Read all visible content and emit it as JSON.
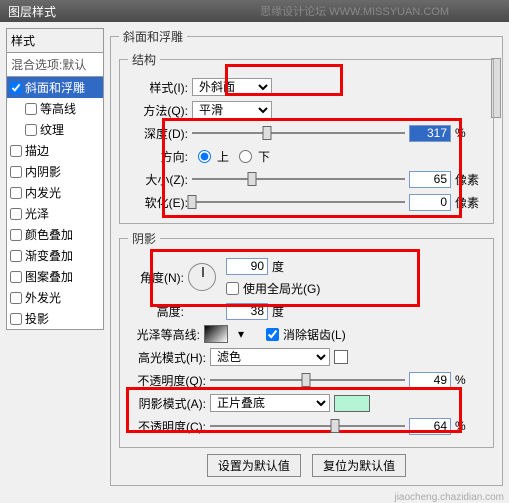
{
  "window": {
    "title": "图层样式"
  },
  "watermark": "思缘设计论坛 WWW.MISSYUAN.COM",
  "sidebar": {
    "header": "样式",
    "default": "混合选项:默认",
    "items": [
      {
        "label": "斜面和浮雕",
        "checked": true,
        "selected": true
      },
      {
        "label": "等高线",
        "checked": false,
        "indent": true
      },
      {
        "label": "纹理",
        "checked": false,
        "indent": true
      },
      {
        "label": "描边",
        "checked": false
      },
      {
        "label": "内阴影",
        "checked": false
      },
      {
        "label": "内发光",
        "checked": false
      },
      {
        "label": "光泽",
        "checked": false
      },
      {
        "label": "颜色叠加",
        "checked": false
      },
      {
        "label": "渐变叠加",
        "checked": false
      },
      {
        "label": "图案叠加",
        "checked": false
      },
      {
        "label": "外发光",
        "checked": false
      },
      {
        "label": "投影",
        "checked": false
      }
    ]
  },
  "panel": {
    "title": "斜面和浮雕",
    "structure": {
      "legend": "结构",
      "style_label": "样式(I):",
      "style_value": "外斜面",
      "method_label": "方法(Q):",
      "method_value": "平滑",
      "depth_label": "深度(D):",
      "depth_value": "317",
      "depth_unit": "%",
      "direction_label": "方向:",
      "up": "上",
      "down": "下",
      "size_label": "大小(Z):",
      "size_value": "65",
      "size_unit": "像素",
      "soften_label": "软化(E):",
      "soften_value": "0",
      "soften_unit": "像素"
    },
    "shadow": {
      "legend": "阴影",
      "angle_label": "角度(N):",
      "angle_value": "90",
      "angle_unit": "度",
      "global_label": "使用全局光(G)",
      "altitude_label": "高度:",
      "altitude_value": "38",
      "altitude_unit": "度",
      "gloss_label": "光泽等高线:",
      "antialias_label": "消除锯齿(L)",
      "hilite_mode_label": "高光模式(H):",
      "hilite_mode_value": "滤色",
      "hilite_op_label": "不透明度(Q):",
      "hilite_op_value": "49",
      "hilite_op_unit": "%",
      "shadow_mode_label": "阴影模式(A):",
      "shadow_mode_value": "正片叠底",
      "shadow_op_label": "不透明度(C):",
      "shadow_op_value": "64",
      "shadow_op_unit": "%"
    },
    "defaults_btn": "设置为默认值",
    "reset_btn": "复位为默认值"
  },
  "footer": "jiaocheng.chazidian.com"
}
